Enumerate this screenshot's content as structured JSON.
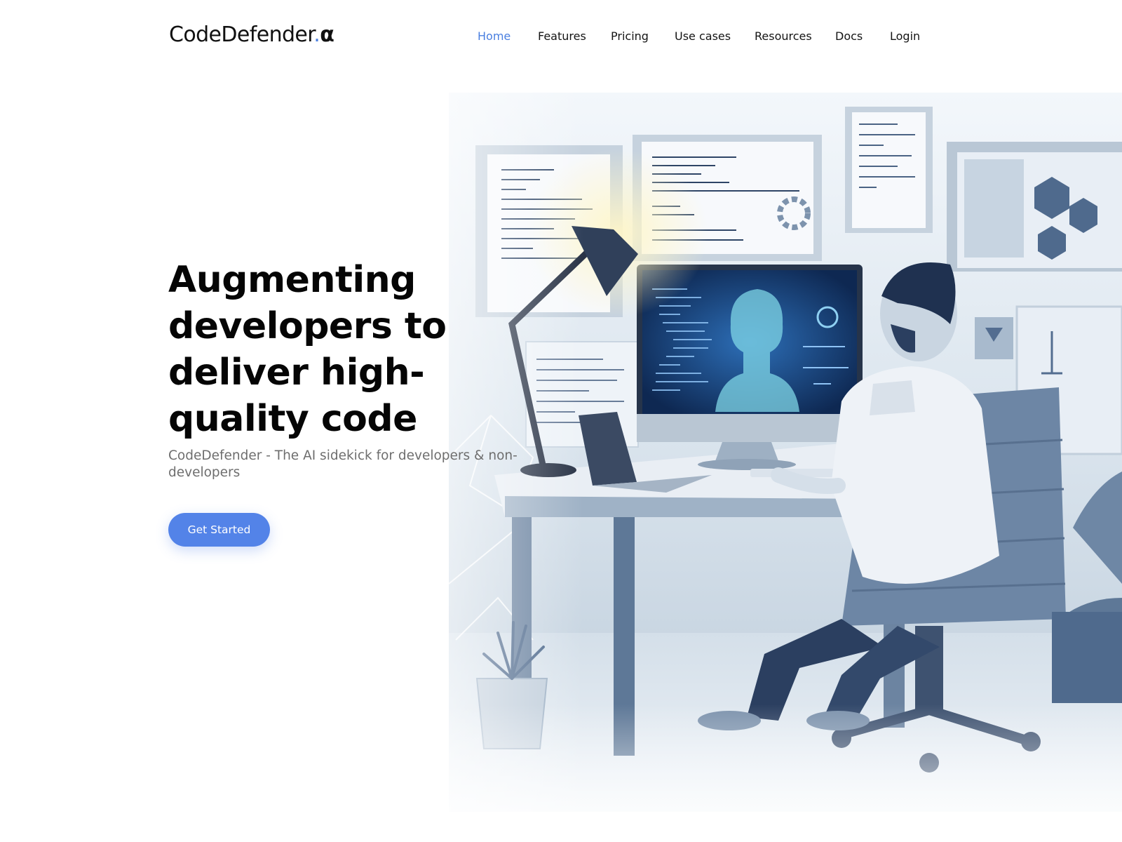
{
  "brand": {
    "name": "CodeDefender",
    "dot": ".",
    "suffix": "α",
    "accent_color": "#4a7fe0"
  },
  "nav": {
    "items": [
      {
        "label": "Home",
        "active": true
      },
      {
        "label": "Features",
        "active": false
      },
      {
        "label": "Pricing",
        "active": false
      },
      {
        "label": "Use cases",
        "active": false
      },
      {
        "label": "Resources",
        "active": false
      },
      {
        "label": "Docs",
        "active": false
      },
      {
        "label": "Login",
        "active": false
      }
    ]
  },
  "hero": {
    "headline": "Augmenting developers to deliver high-quality code",
    "subtitle": "CodeDefender - The AI sidekick for developers & non-developers",
    "cta_label": "Get Started",
    "cta_color": "#5383e8",
    "image_alt": "Illustration of a developer at a desk working with an AI assistant on screen"
  }
}
